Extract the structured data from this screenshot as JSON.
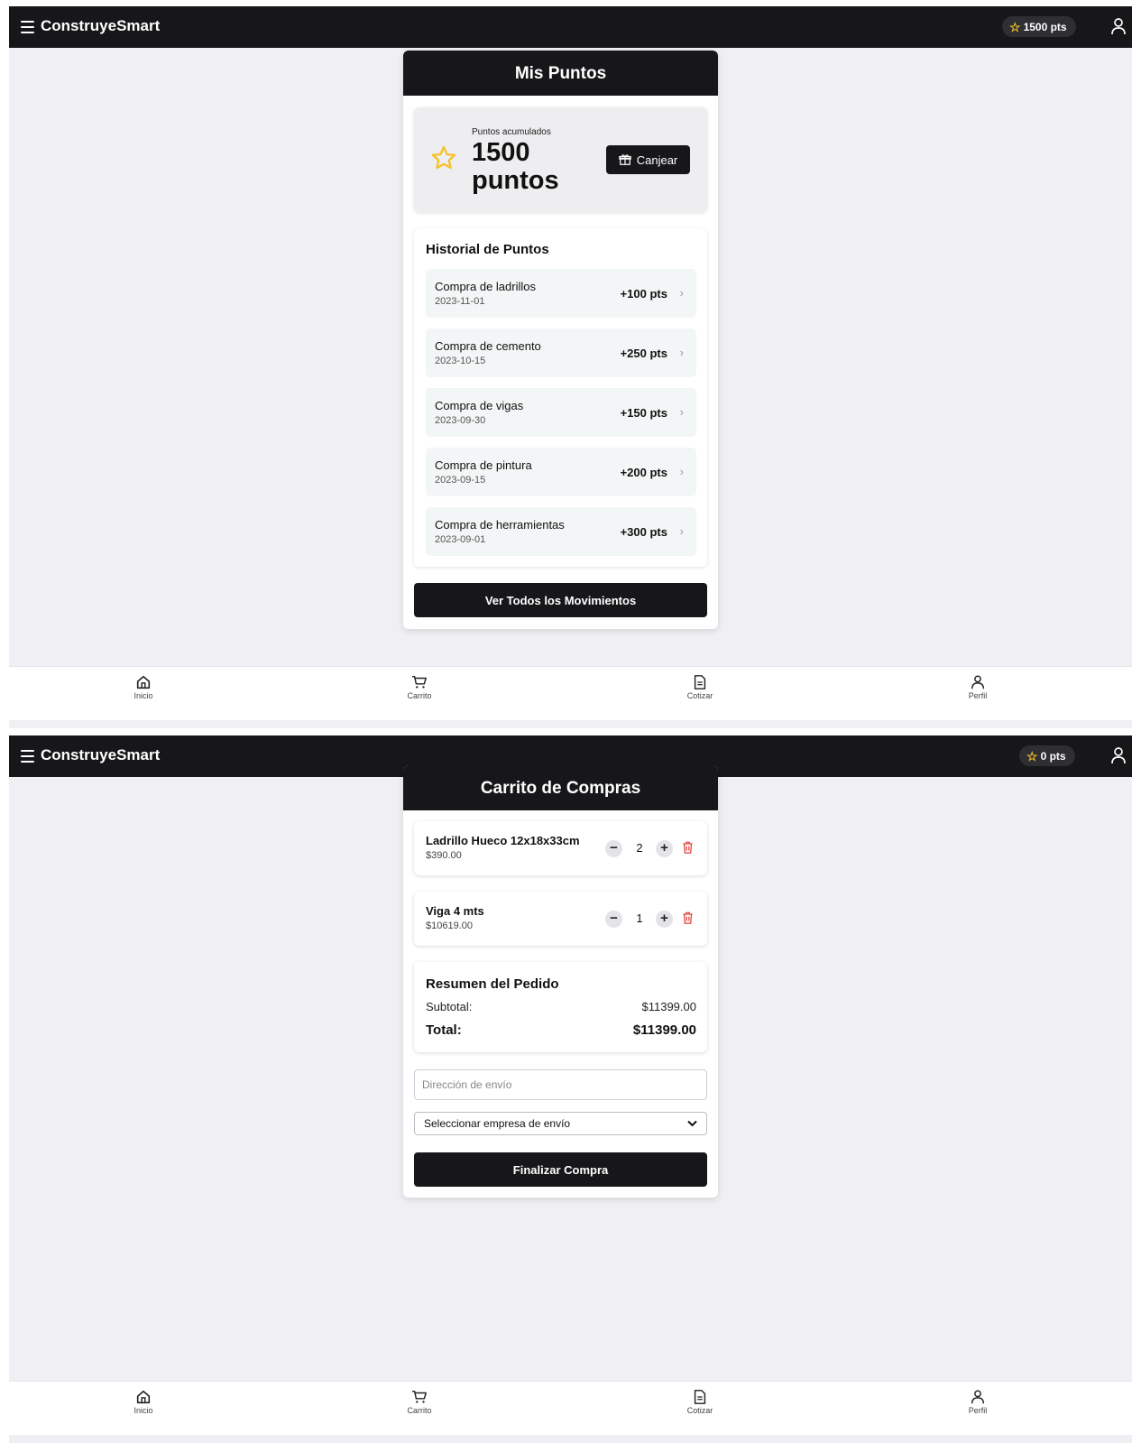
{
  "app": {
    "brand": "ConstruyeSmart"
  },
  "colors": {
    "dark": "#17171a",
    "star": "#f6c026",
    "accent_bg": "#f0f0f4",
    "danger": "#e53935"
  },
  "nav": [
    {
      "label": "Inicio",
      "icon": "home-icon"
    },
    {
      "label": "Carrito",
      "icon": "cart-icon"
    },
    {
      "label": "Cotizar",
      "icon": "document-icon"
    },
    {
      "label": "Perfil",
      "icon": "user-icon"
    }
  ],
  "screen1": {
    "badge": "1500 pts",
    "title": "Mis Puntos",
    "points_label": "Puntos acumulados",
    "points_value": "1500 puntos",
    "redeem_label": "Canjear",
    "history_title": "Historial de Puntos",
    "history": [
      {
        "name": "Compra de ladrillos",
        "date": "2023-11-01",
        "points": "+100 pts"
      },
      {
        "name": "Compra de cemento",
        "date": "2023-10-15",
        "points": "+250 pts"
      },
      {
        "name": "Compra de vigas",
        "date": "2023-09-30",
        "points": "+150 pts"
      },
      {
        "name": "Compra de pintura",
        "date": "2023-09-15",
        "points": "+200 pts"
      },
      {
        "name": "Compra de herramientas",
        "date": "2023-09-01",
        "points": "+300 pts"
      }
    ],
    "view_all": "Ver Todos los Movimientos"
  },
  "screen2": {
    "badge": "0 pts",
    "title": "Carrito de Compras",
    "items": [
      {
        "name": "Ladrillo Hueco 12x18x33cm",
        "price": "$390.00",
        "qty": "2"
      },
      {
        "name": "Viga 4 mts",
        "price": "$10619.00",
        "qty": "1"
      }
    ],
    "summary": {
      "title": "Resumen del Pedido",
      "subtotal_label": "Subtotal:",
      "subtotal": "$11399.00",
      "total_label": "Total:",
      "total": "$11399.00"
    },
    "address_placeholder": "Dirección de envío",
    "shipping_select": "Seleccionar empresa de envío",
    "checkout": "Finalizar Compra"
  }
}
